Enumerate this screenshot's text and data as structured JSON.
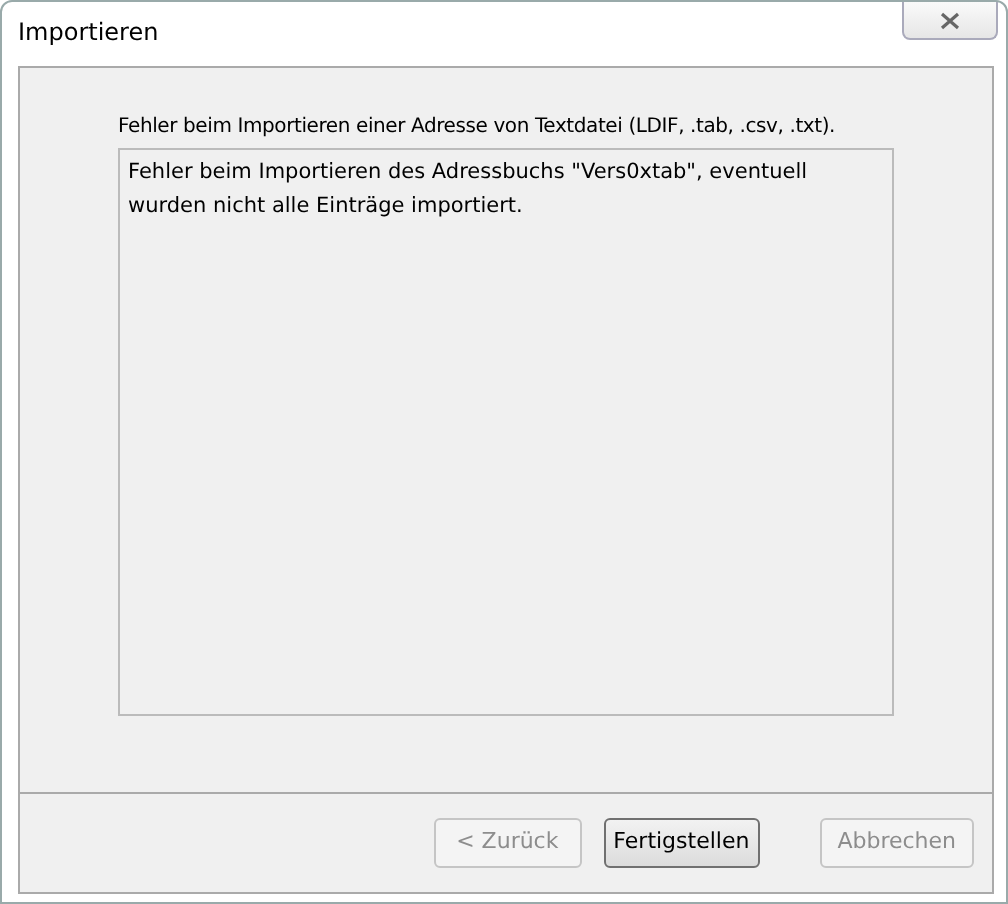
{
  "window": {
    "title": "Importieren"
  },
  "heading": "Fehler beim Importieren einer Adresse von Textdatei (LDIF, .tab, .csv, .txt).",
  "message": "Fehler beim Importieren des Adressbuchs \"Vers0xtab\", eventuell wurden nicht alle Einträge importiert.",
  "buttons": [
    {
      "label": "< Zurück",
      "disabled": true,
      "kind": "back"
    },
    {
      "label": "Fertigstellen",
      "disabled": false,
      "kind": "finish"
    },
    {
      "label": "Abbrechen",
      "disabled": true,
      "kind": "cancel"
    }
  ]
}
